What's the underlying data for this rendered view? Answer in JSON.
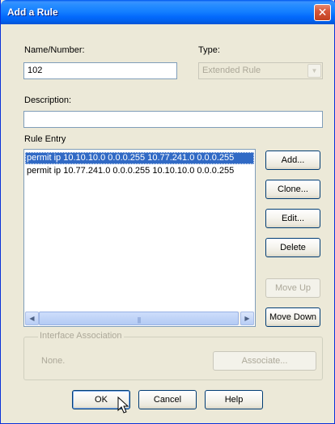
{
  "window": {
    "title": "Add a Rule",
    "close_glyph": "✕"
  },
  "fields": {
    "name_label": "Name/Number:",
    "name_value": "102",
    "type_label": "Type:",
    "type_value": "Extended Rule",
    "description_label": "Description:",
    "description_value": ""
  },
  "rule_entry": {
    "label": "Rule Entry",
    "rows": [
      {
        "text": "permit ip 10.10.10.0 0.0.0.255 10.77.241.0 0.0.0.255",
        "selected": true
      },
      {
        "text": "permit ip 10.77.241.0 0.0.0.255 10.10.10.0 0.0.0.255",
        "selected": false
      }
    ]
  },
  "side_buttons": {
    "add": "Add...",
    "clone": "Clone...",
    "edit": "Edit...",
    "delete": "Delete",
    "move_up": "Move Up",
    "move_down": "Move Down"
  },
  "interface_association": {
    "legend": "Interface Association",
    "value": "None.",
    "associate_button": "Associate..."
  },
  "footer": {
    "ok": "OK",
    "cancel": "Cancel",
    "help": "Help"
  },
  "icons": {
    "close": "close-icon",
    "dropdown": "chevron-down-icon",
    "scroll_left": "arrow-left-icon",
    "scroll_right": "arrow-right-icon",
    "cursor": "mouse-pointer-icon"
  },
  "colors": {
    "title_bar": "#0a5ef0",
    "selection": "#316ac5",
    "disabled_text": "#aca899"
  }
}
